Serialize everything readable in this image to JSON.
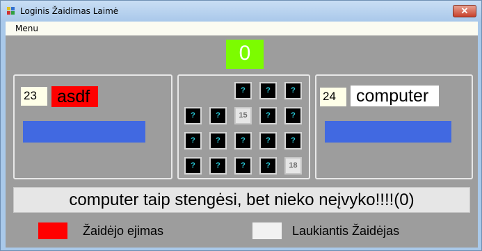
{
  "window": {
    "title": "Loginis Žaidimas Laimė",
    "close_label": "✕"
  },
  "menu": {
    "items": [
      {
        "label": "Menu"
      }
    ]
  },
  "counter": {
    "value": "0"
  },
  "player1": {
    "score": "23",
    "name": "asdf",
    "name_bg": "#ff0000"
  },
  "player2": {
    "score": "24",
    "name": "computer",
    "name_bg": "#ffffff"
  },
  "board": {
    "cards": [
      {
        "label": "?",
        "state": "hidden"
      },
      {
        "label": "?",
        "state": "hidden"
      },
      {
        "label": "?",
        "state": "hidden"
      },
      {
        "label": "?",
        "state": "hidden"
      },
      {
        "label": "?",
        "state": "hidden"
      },
      {
        "label": "15",
        "state": "open"
      },
      {
        "label": "?",
        "state": "hidden"
      },
      {
        "label": "?",
        "state": "hidden"
      },
      {
        "label": "?",
        "state": "hidden"
      },
      {
        "label": "?",
        "state": "hidden"
      },
      {
        "label": "?",
        "state": "hidden"
      },
      {
        "label": "?",
        "state": "hidden"
      },
      {
        "label": "?",
        "state": "hidden"
      },
      {
        "label": "?",
        "state": "hidden"
      },
      {
        "label": "?",
        "state": "hidden"
      },
      {
        "label": "?",
        "state": "hidden"
      },
      {
        "label": "?",
        "state": "hidden"
      },
      {
        "label": "18",
        "state": "open"
      }
    ]
  },
  "status": {
    "text": "computer  taip stengėsi, bet nieko neįvyko!!!!(0)"
  },
  "legend": {
    "active": {
      "label": "Žaidėjo ejimas",
      "color": "#ff0000"
    },
    "waiting": {
      "label": "Laukiantis Žaidėjas",
      "color": "#f2f2f2"
    }
  },
  "colors": {
    "bar": "#4169e1",
    "counter_bg": "#7cfc00",
    "card_back": "#000000",
    "card_mark": "#29d0e0"
  }
}
